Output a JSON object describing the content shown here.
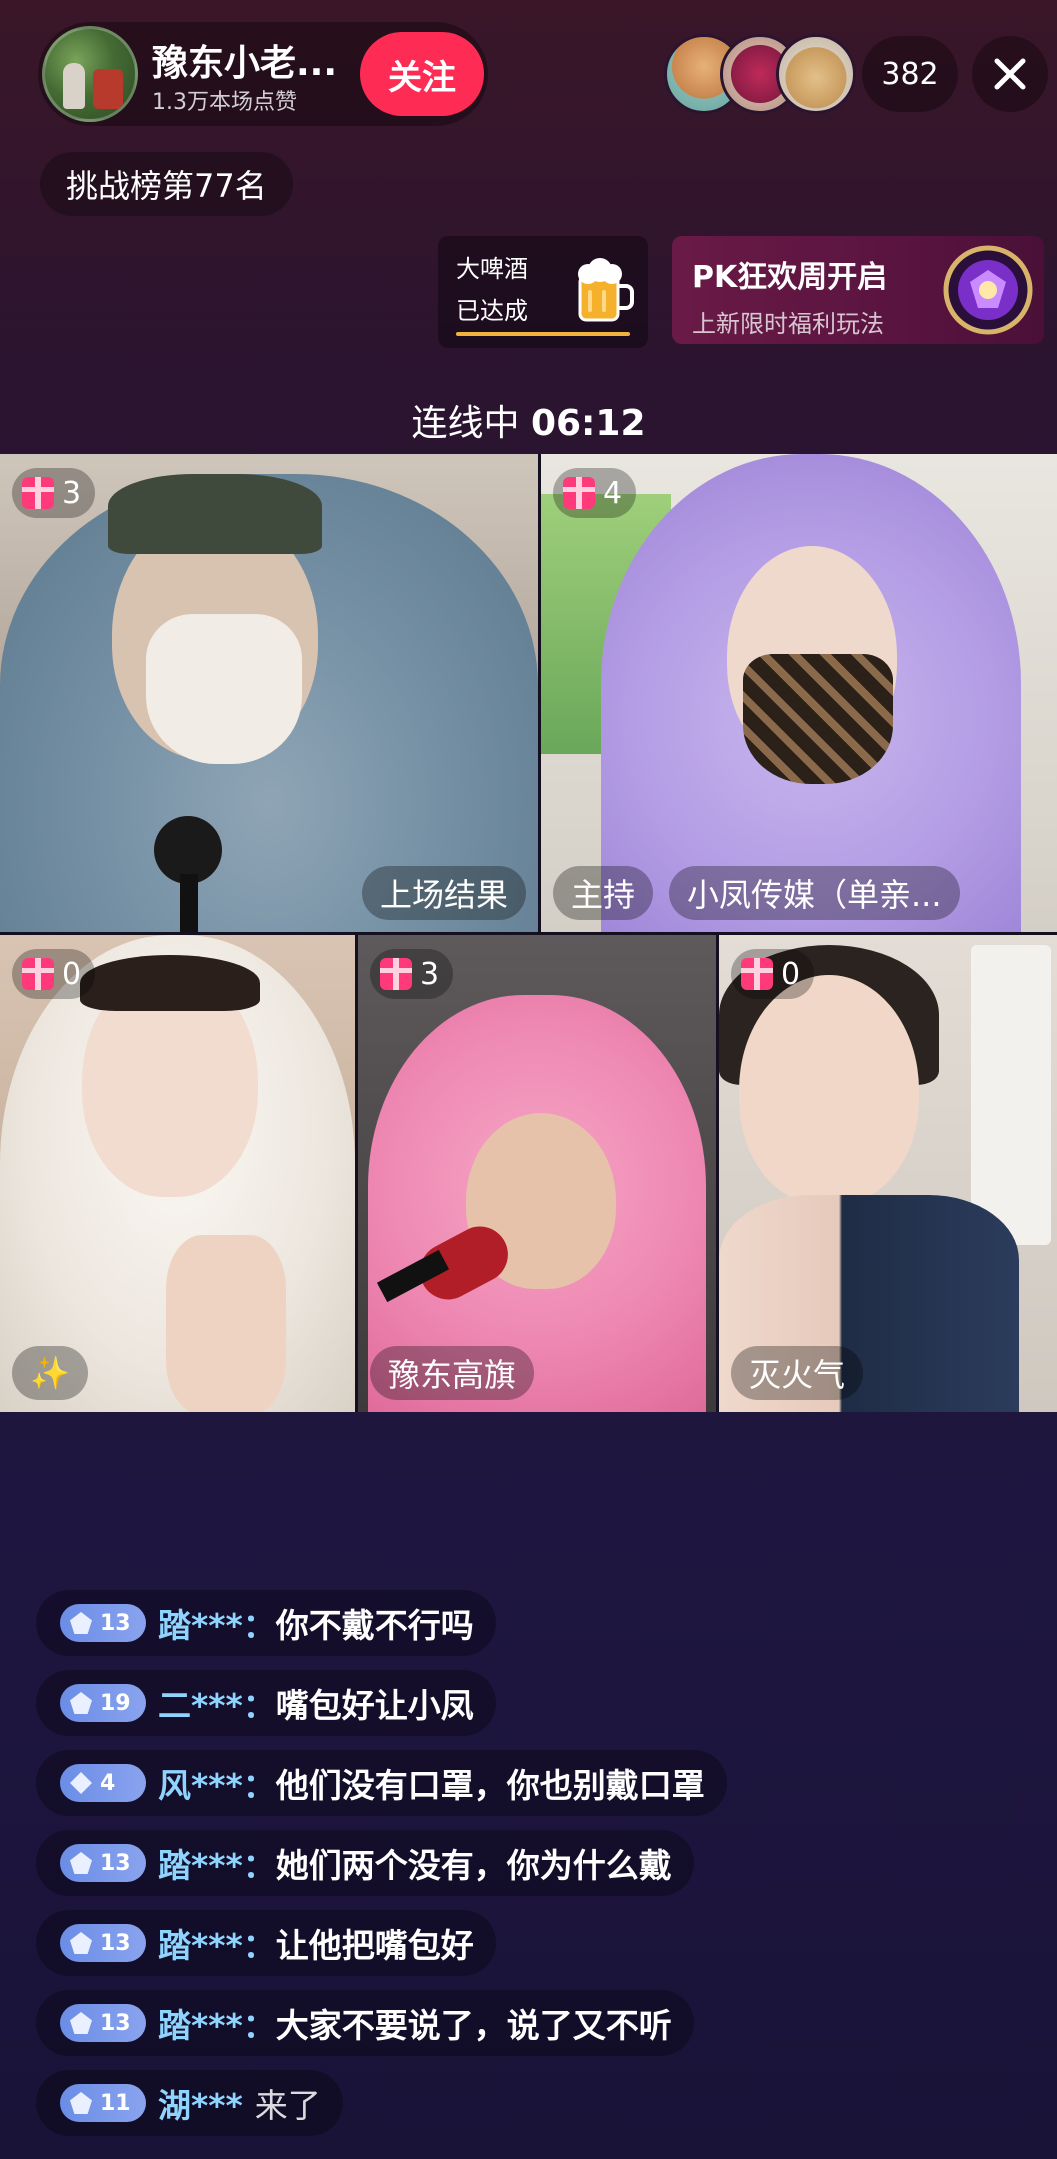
{
  "host": {
    "name": "豫东小老...",
    "likes": "1.3万本场点赞",
    "follow_label": "关注"
  },
  "viewers": {
    "count": "382"
  },
  "rank": {
    "label": "挑战榜第77名"
  },
  "task_card": {
    "line1": "大啤酒",
    "line2": "已达成",
    "progress": 1.0
  },
  "promo": {
    "title": "PK狂欢周开启",
    "subtitle": "上新限时福利玩法"
  },
  "connection": {
    "label": "连线中",
    "time": "06:12"
  },
  "tiles": [
    {
      "gift_count": "3",
      "name": "上场结果"
    },
    {
      "gift_count": "4",
      "host_tag": "主持",
      "name": "小凤传媒（单亲..."
    },
    {
      "gift_count": "0",
      "name": "✨"
    },
    {
      "gift_count": "3",
      "name": "豫东高旗"
    },
    {
      "gift_count": "0",
      "name": "灭火气"
    }
  ],
  "chat": [
    {
      "level": "13",
      "badge": "pentagon",
      "user": "踏***：",
      "message": "你不戴不行吗"
    },
    {
      "level": "19",
      "badge": "pentagon",
      "user": "二***：",
      "message": "嘴包好让小凤"
    },
    {
      "level": "4",
      "badge": "diamond",
      "user": "风***：",
      "message": "他们没有口罩，你也别戴口罩"
    },
    {
      "level": "13",
      "badge": "pentagon",
      "user": "踏***：",
      "message": "她们两个没有，你为什么戴"
    },
    {
      "level": "13",
      "badge": "pentagon",
      "user": "踏***：",
      "message": "让他把嘴包好"
    },
    {
      "level": "13",
      "badge": "pentagon",
      "user": "踏***：",
      "message": "大家不要说了，说了又不听"
    },
    {
      "level": "11",
      "badge": "pentagon",
      "user": "湖***",
      "join": "来了"
    }
  ],
  "colors": {
    "follow": "#fe2c55",
    "chat_user": "#8fd3ff",
    "level_badge": "#6a8de6",
    "progress": "#f2b33d"
  }
}
